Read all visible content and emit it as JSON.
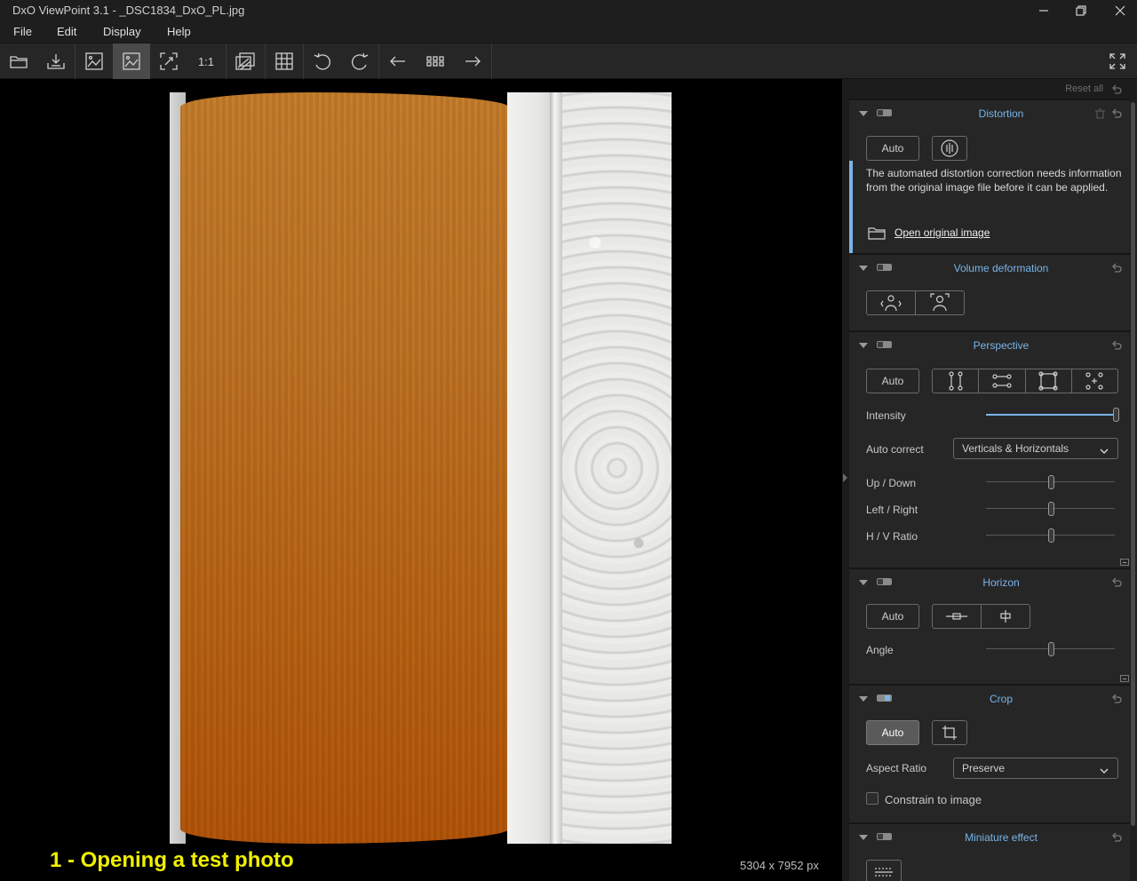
{
  "window": {
    "title": "DxO ViewPoint 3.1 - _DSC1834_DxO_PL.jpg"
  },
  "menu": [
    "File",
    "Edit",
    "Display",
    "Help"
  ],
  "toolbar": {
    "one_to_one": "1:1"
  },
  "viewer": {
    "caption": "1 - Opening a test photo",
    "dimensions": "5304 x 7952 px"
  },
  "panel": {
    "reset_all": "Reset all",
    "distortion": {
      "title": "Distortion",
      "auto": "Auto",
      "info": "The automated distortion correction needs information from the original image file before it can be applied.",
      "open_link": "Open original image"
    },
    "volume": {
      "title": "Volume deformation"
    },
    "perspective": {
      "title": "Perspective",
      "auto": "Auto",
      "intensity_label": "Intensity",
      "intensity_value": 1.0,
      "auto_correct_label": "Auto correct",
      "auto_correct_value": "Verticals & Horizontals",
      "up_down_label": "Up / Down",
      "up_down_value": 0.5,
      "left_right_label": "Left / Right",
      "left_right_value": 0.5,
      "hv_ratio_label": "H / V Ratio",
      "hv_ratio_value": 0.5
    },
    "horizon": {
      "title": "Horizon",
      "auto": "Auto",
      "angle_label": "Angle",
      "angle_value": 0.5
    },
    "crop": {
      "title": "Crop",
      "auto": "Auto",
      "aspect_label": "Aspect Ratio",
      "aspect_value": "Preserve",
      "constrain_label": "Constrain to image"
    },
    "miniature": {
      "title": "Miniature effect"
    }
  },
  "colors": {
    "accent": "#79b4e8",
    "caption": "#f0f000"
  }
}
